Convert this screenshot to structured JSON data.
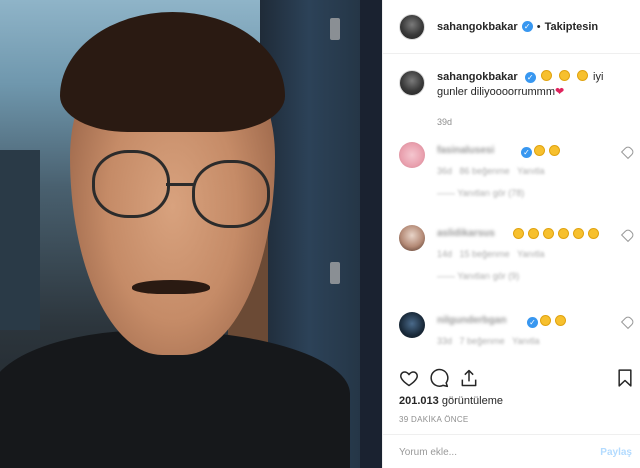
{
  "post": {
    "username": "sahangokbakar",
    "follow_label": "Takiptesin",
    "separator": "•",
    "caption_user": "sahangokbakar",
    "caption_word": "iyi",
    "caption_text": "gunler diliyoooorrummm",
    "caption_age": "39d",
    "views_count": "201.013",
    "views_label": "görüntüleme",
    "timestamp": "39 DAKİKA ÖNCE",
    "comment_placeholder": "Yorum ekle...",
    "post_label": "Paylaş"
  },
  "comments": [
    {
      "user": "fasinalusesi",
      "time": "36d",
      "likes": "86 beğenme",
      "reply": "Yanıtla",
      "replies": "—— Yanıtları gör (78)"
    },
    {
      "user": "aslidikarsus",
      "time": "14d",
      "likes": "15 beğenme",
      "reply": "Yanıtla",
      "replies": "—— Yanıtları gör (9)"
    },
    {
      "user": "nilgunderbgan",
      "time": "33d",
      "likes": "7 beğenme",
      "reply": "Yanıtla",
      "replies": ""
    }
  ],
  "colors": {
    "verified": "#3897f0",
    "heart": "#e0245e",
    "post_button": "#b3dbff"
  },
  "icons": [
    "verified-badge-icon",
    "heart-icon",
    "comment-icon",
    "share-icon",
    "bookmark-icon",
    "like-comment-icon",
    "laughing-emoji-icon"
  ]
}
